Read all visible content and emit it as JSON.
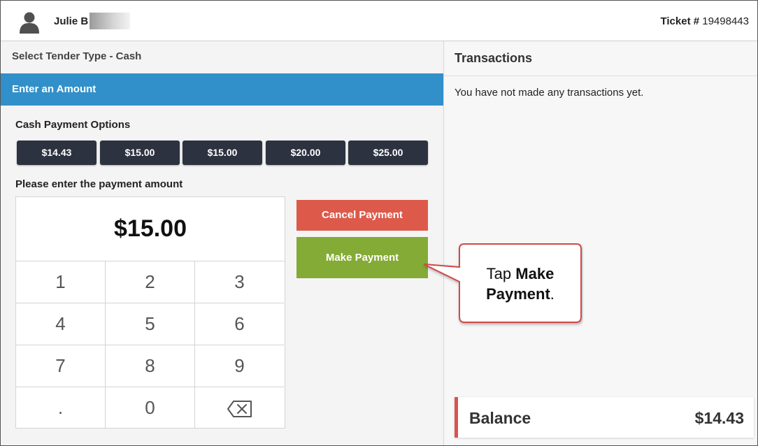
{
  "header": {
    "user_name": "Julie B",
    "ticket_label": "Ticket #",
    "ticket_number": "19498443"
  },
  "payment": {
    "tender_title": "Select Tender Type - Cash",
    "amount_bar": "Enter an Amount",
    "cash_options_label": "Cash Payment Options",
    "cash_options": [
      "$14.43",
      "$15.00",
      "$15.00",
      "$20.00",
      "$25.00"
    ],
    "enter_amount_label": "Please enter the payment amount",
    "amount_value": "$15.00",
    "keys": [
      "1",
      "2",
      "3",
      "4",
      "5",
      "6",
      "7",
      "8",
      "9",
      ".",
      "0"
    ],
    "cancel_label": "Cancel Payment",
    "make_label": "Make Payment"
  },
  "transactions": {
    "title": "Transactions",
    "empty_text": "You have not made any transactions yet.",
    "balance_label": "Balance",
    "balance_value": "$14.43"
  },
  "callout": {
    "prefix": "Tap",
    "bold": "Make Payment",
    "suffix": "."
  },
  "icons": {
    "avatar": "user-silhouette-icon",
    "backspace": "backspace-icon"
  },
  "colors": {
    "accent_blue": "#3190c9",
    "cancel_red": "#dd5a4b",
    "make_green": "#84ab35",
    "dark_button": "#2d3240",
    "balance_red": "#d9534f"
  }
}
